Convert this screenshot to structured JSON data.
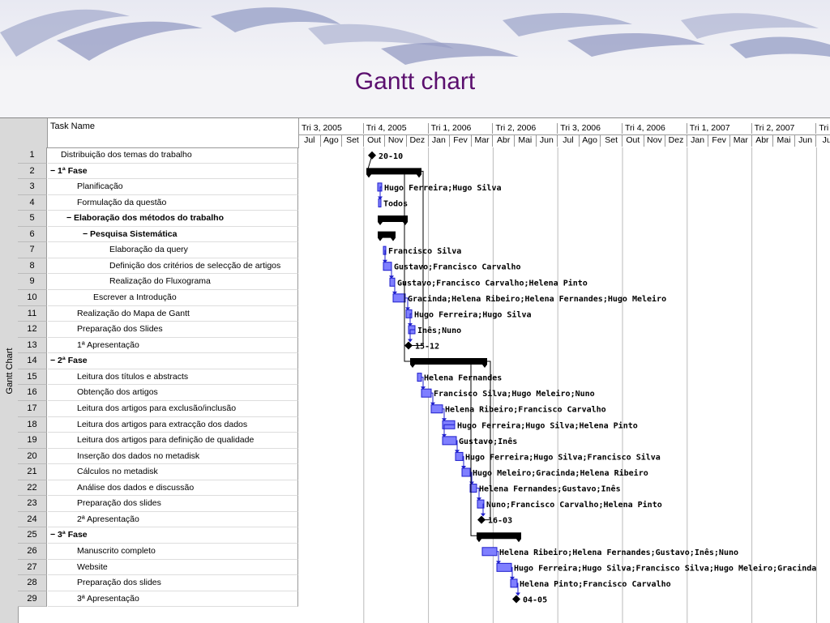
{
  "slide": {
    "title": "Gantt chart"
  },
  "view": {
    "label": "Gantt Chart",
    "task_name_header": "Task Name"
  },
  "timescale": {
    "quarters": [
      "Tri 3, 2005",
      "Tri 4, 2005",
      "Tri 1, 2006",
      "Tri 2, 2006",
      "Tri 3, 2006",
      "Tri 4, 2006",
      "Tri 1, 2007",
      "Tri 2, 2007",
      "Tri"
    ],
    "months": [
      "Jul",
      "Ago",
      "Set",
      "Out",
      "Nov",
      "Dez",
      "Jan",
      "Fev",
      "Mar",
      "Abr",
      "Mai",
      "Jun",
      "Jul",
      "Ago",
      "Set",
      "Out",
      "Nov",
      "Dez",
      "Jan",
      "Fev",
      "Mar",
      "Abr",
      "Mai",
      "Jun",
      "Ju"
    ]
  },
  "tasks": [
    {
      "id": "1",
      "name": "Distribuição dos temas do trabalho",
      "level": 0,
      "type": "milestone",
      "label": "20-10"
    },
    {
      "id": "2",
      "name": "− 1ª Fase",
      "level": 0,
      "type": "summary",
      "label": ""
    },
    {
      "id": "3",
      "name": "Planificação",
      "level": 1,
      "type": "task",
      "label": "Hugo Ferreira;Hugo Silva"
    },
    {
      "id": "4",
      "name": "Formulação da questão",
      "level": 1,
      "type": "task",
      "label": "Todos"
    },
    {
      "id": "5",
      "name": "− Elaboração dos métodos do trabalho",
      "level": 1,
      "type": "summary",
      "label": ""
    },
    {
      "id": "6",
      "name": "− Pesquisa Sistemática",
      "level": 2,
      "type": "summary",
      "label": ""
    },
    {
      "id": "7",
      "name": "Elaboração da query",
      "level": 3,
      "type": "task",
      "label": "Francisco Silva"
    },
    {
      "id": "8",
      "name": "Definição dos critérios de selecção de artigos",
      "level": 3,
      "type": "task",
      "label": "Gustavo;Francisco Carvalho"
    },
    {
      "id": "9",
      "name": "Realização do Fluxograma",
      "level": 3,
      "type": "task",
      "label": "Gustavo;Francisco Carvalho;Helena Pinto"
    },
    {
      "id": "10",
      "name": "Escrever a Introdução",
      "level": 2,
      "type": "task",
      "label": "Gracinda;Helena Ribeiro;Helena Fernandes;Hugo Meleiro"
    },
    {
      "id": "11",
      "name": "Realização do Mapa de Gantt",
      "level": 1,
      "type": "task",
      "label": "Hugo Ferreira;Hugo Silva"
    },
    {
      "id": "12",
      "name": "Preparação dos Slides",
      "level": 1,
      "type": "task",
      "label": "Inês;Nuno"
    },
    {
      "id": "13",
      "name": "1ª Apresentação",
      "level": 1,
      "type": "milestone",
      "label": "15-12"
    },
    {
      "id": "14",
      "name": "− 2ª Fase",
      "level": 0,
      "type": "summary",
      "label": ""
    },
    {
      "id": "15",
      "name": "Leitura dos títulos e abstracts",
      "level": 1,
      "type": "task",
      "label": "Helena Fernandes"
    },
    {
      "id": "16",
      "name": "Obtenção dos artigos",
      "level": 1,
      "type": "task",
      "label": "Francisco Silva;Hugo Meleiro;Nuno"
    },
    {
      "id": "17",
      "name": "Leitura dos artigos para exclusão/inclusão",
      "level": 1,
      "type": "task",
      "label": "Helena Ribeiro;Francisco Carvalho"
    },
    {
      "id": "18",
      "name": "Leitura dos artigos para extracção dos dados",
      "level": 1,
      "type": "task",
      "label": "Hugo Ferreira;Hugo Silva;Helena Pinto"
    },
    {
      "id": "19",
      "name": "Leitura dos artigos para definição de qualidade",
      "level": 1,
      "type": "task",
      "label": "Gustavo;Inês"
    },
    {
      "id": "20",
      "name": "Inserção dos dados no metadisk",
      "level": 1,
      "type": "task",
      "label": "Hugo Ferreira;Hugo Silva;Francisco Silva"
    },
    {
      "id": "21",
      "name": "Cálculos no metadisk",
      "level": 1,
      "type": "task",
      "label": "Hugo Meleiro;Gracinda;Helena Ribeiro"
    },
    {
      "id": "22",
      "name": "Análise dos dados e discussão",
      "level": 1,
      "type": "task",
      "label": "Helena Fernandes;Gustavo;Inês"
    },
    {
      "id": "23",
      "name": "Preparação dos slides",
      "level": 1,
      "type": "task",
      "label": "Nuno;Francisco Carvalho;Helena Pinto"
    },
    {
      "id": "24",
      "name": "2ª Apresentação",
      "level": 1,
      "type": "milestone",
      "label": "16-03"
    },
    {
      "id": "25",
      "name": "− 3ª Fase",
      "level": 0,
      "type": "summary",
      "label": ""
    },
    {
      "id": "26",
      "name": "Manuscrito completo",
      "level": 1,
      "type": "task",
      "label": "Helena Ribeiro;Helena Fernandes;Gustavo;Inês;Nuno"
    },
    {
      "id": "27",
      "name": "Website",
      "level": 1,
      "type": "task",
      "label": "Hugo Ferreira;Hugo Silva;Francisco Silva;Hugo Meleiro;Gracinda"
    },
    {
      "id": "28",
      "name": "Preparação dos slides",
      "level": 1,
      "type": "task",
      "label": "Helena Pinto;Francisco Carvalho"
    },
    {
      "id": "29",
      "name": "3ª Apresentação",
      "level": 1,
      "type": "milestone",
      "label": "04-05"
    }
  ],
  "colors": {
    "bar_fill": "#7f7fff",
    "bar_border": "#1f1fcc",
    "summary": "#000000",
    "link": "#1f1fcc",
    "title": "#5b0f6e"
  }
}
